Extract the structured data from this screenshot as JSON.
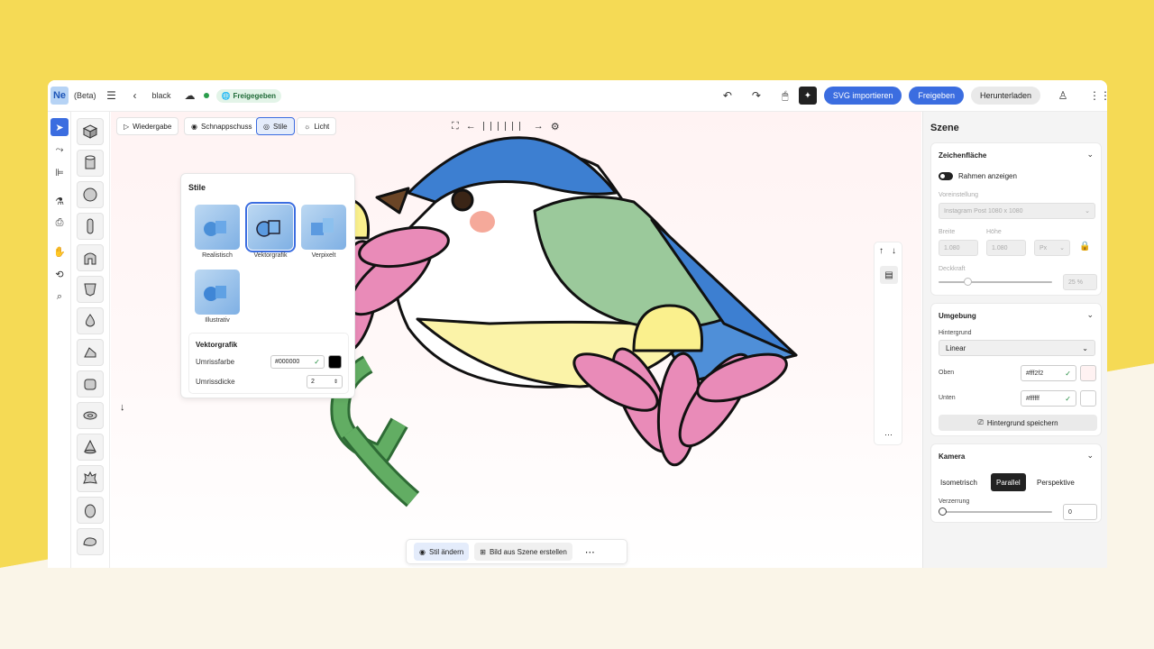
{
  "topbar": {
    "logo": "Ne",
    "beta": "(Beta)",
    "filename": "black",
    "shared": "Freigegeben",
    "import_svg": "SVG importieren",
    "share": "Freigeben",
    "download": "Herunterladen"
  },
  "canvas_toolbar": {
    "playback": "Wiedergabe",
    "snapshot": "Schnappschuss",
    "styles": "Stile",
    "light": "Licht"
  },
  "styles_panel": {
    "title": "Stile",
    "cards": [
      {
        "label": "Realistisch",
        "selected": false
      },
      {
        "label": "Vektorgrafik",
        "selected": true
      },
      {
        "label": "Verpixelt",
        "selected": false
      },
      {
        "label": "Illustrativ",
        "selected": false
      }
    ],
    "vector": {
      "title": "Vektorgrafik",
      "outline_color_label": "Umrissfarbe",
      "outline_color": "#000000",
      "outline_width_label": "Umrissdicke",
      "outline_width": "2"
    }
  },
  "bottom_bar": {
    "change_style": "Stil ändern",
    "image_from_scene": "Bild aus Szene erstellen",
    "more": "⋯"
  },
  "right_panel": {
    "title": "Szene",
    "artboard": {
      "title": "Zeichenfläche",
      "show_frame": "Rahmen anzeigen",
      "preset_label": "Voreinstellung",
      "preset_value": "Instagram Post 1080 x 1080",
      "width_label": "Breite",
      "width": "1.080",
      "height_label": "Höhe",
      "height": "1.080",
      "unit": "Px",
      "opacity_label": "Deckkraft",
      "opacity": "25 %"
    },
    "environment": {
      "title": "Umgebung",
      "background_label": "Hintergrund",
      "background_value": "Linear",
      "top_label": "Oben",
      "top_value": "#fff2f2",
      "bottom_label": "Unten",
      "bottom_value": "#ffffff",
      "save_bg": "Hintergrund speichern"
    },
    "camera": {
      "title": "Kamera",
      "modes": [
        "Isometrisch",
        "Parallel",
        "Perspektive"
      ],
      "selected": "Parallel",
      "distortion_label": "Verzerrung",
      "distortion_value": "0"
    }
  },
  "colors": {
    "accent": "#3b6de0",
    "canvas_top": "#fff2f2",
    "canvas_bottom": "#ffffff"
  }
}
